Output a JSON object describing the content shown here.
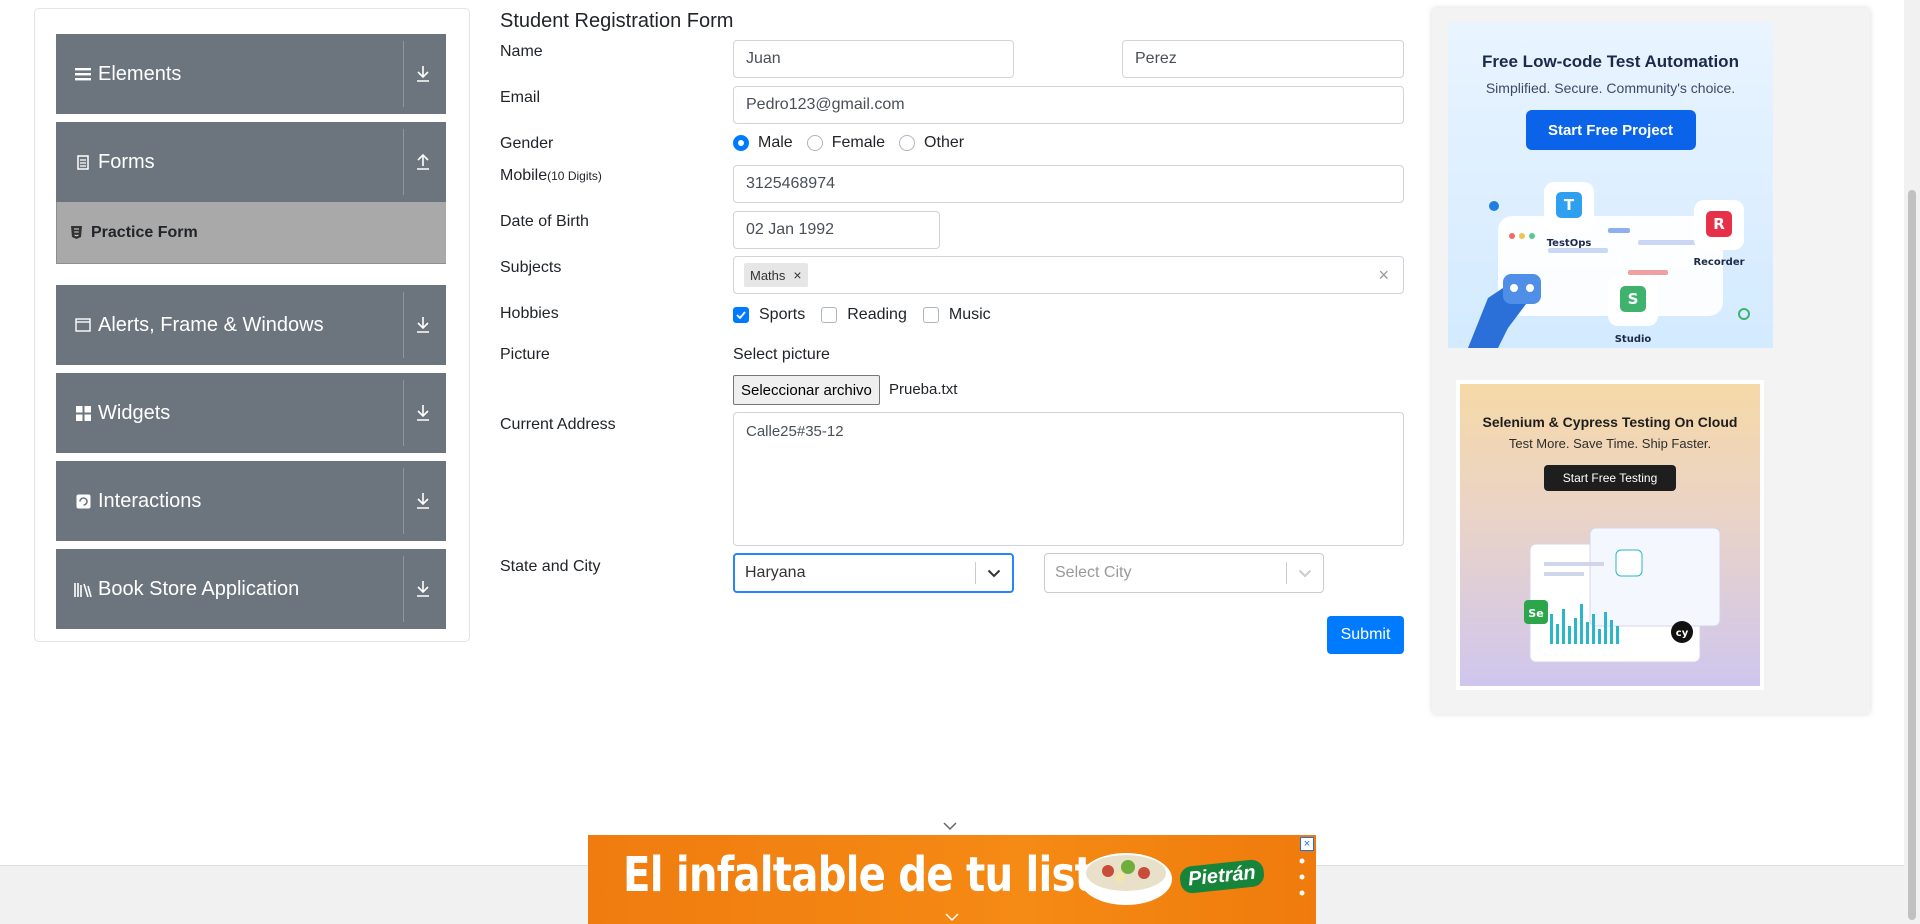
{
  "sidebar": {
    "groups": [
      {
        "label": "Elements",
        "icon": "menu-icon",
        "arrow": "download-icon"
      },
      {
        "label": "Forms",
        "icon": "document-icon",
        "arrow": "upload-icon"
      },
      {
        "label": "Alerts, Frame & Windows",
        "icon": "window-icon",
        "arrow": "download-icon"
      },
      {
        "label": "Widgets",
        "icon": "widgets-icon",
        "arrow": "download-icon"
      },
      {
        "label": "Interactions",
        "icon": "interactions-icon",
        "arrow": "download-icon"
      },
      {
        "label": "Book Store Application",
        "icon": "books-icon",
        "arrow": "download-icon"
      }
    ],
    "active_item": {
      "label": "Practice Form",
      "icon": "html5-icon"
    }
  },
  "form": {
    "title": "Student Registration Form",
    "name": {
      "label": "Name",
      "first": "Juan",
      "last": "Perez"
    },
    "email": {
      "label": "Email",
      "value": "Pedro123@gmail.com"
    },
    "gender": {
      "label": "Gender",
      "options": [
        "Male",
        "Female",
        "Other"
      ],
      "selected": "Male"
    },
    "mobile": {
      "label": "Mobile",
      "hint": "(10 Digits)",
      "value": "3125468974"
    },
    "dob": {
      "label": "Date of Birth",
      "value": "02 Jan 1992"
    },
    "subjects": {
      "label": "Subjects",
      "chips": [
        "Maths"
      ],
      "chip_remove": "×",
      "clear": "×"
    },
    "hobbies": {
      "label": "Hobbies",
      "options": [
        "Sports",
        "Reading",
        "Music"
      ],
      "checked": [
        "Sports"
      ]
    },
    "picture": {
      "label": "Picture",
      "prompt": "Select picture",
      "button": "Seleccionar archivo",
      "file": "Prueba.txt"
    },
    "address": {
      "label": "Current Address",
      "value": "Calle25#35-12"
    },
    "state_city": {
      "label": "State and City",
      "state": "Haryana",
      "city_placeholder": "Select City"
    },
    "submit": "Submit"
  },
  "ads": {
    "ad1": {
      "title": "Free Low-code Test Automation",
      "subtitle": "Simplified. Secure. Community's choice.",
      "button": "Start Free Project",
      "labels": [
        "TestOps",
        "Recorder",
        "Studio"
      ]
    },
    "ad2": {
      "title": "Selenium & Cypress Testing On Cloud",
      "subtitle": "Test More. Save Time. Ship Faster.",
      "button": "Start Free Testing"
    }
  },
  "banner": {
    "headline": "El infaltable de tu lista",
    "brand": "Pietrán",
    "close": "×"
  },
  "colors": {
    "sidebar": "#6c757d",
    "active_item": "#a9a9a9",
    "primary": "#007bff",
    "banner": "#f58a14"
  }
}
